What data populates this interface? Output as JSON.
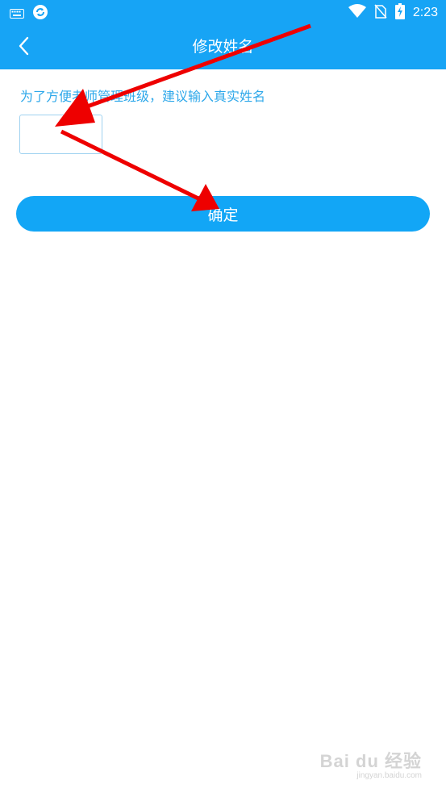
{
  "status_bar": {
    "time": "2:23",
    "icons": [
      "keyboard-icon",
      "sync-icon",
      "wifi-icon",
      "no-sim-icon",
      "battery-charging-icon"
    ]
  },
  "header": {
    "title": "修改姓名",
    "back_icon": "chevron-left-icon",
    "background": "#17a4f5"
  },
  "form": {
    "hint": "为了方便老师管理班级，建议输入真实姓名",
    "name_value": "",
    "name_placeholder": "",
    "confirm_label": "确定",
    "accent": "#12a6f6"
  },
  "annotations": {
    "arrow_color": "#ee0000"
  },
  "watermark": {
    "brand": "Bai du 经验",
    "sub": "jingyan.baidu.com"
  }
}
